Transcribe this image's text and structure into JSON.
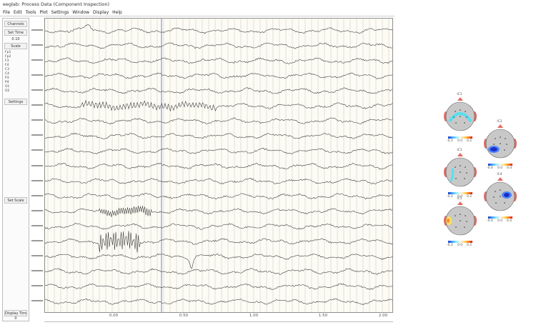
{
  "window": {
    "title": "eeglab: Process Data (Component Inspection)"
  },
  "menubar": [
    "File",
    "Edit",
    "Tools",
    "Plot",
    "Settings",
    "Window",
    "Display",
    "Help"
  ],
  "left_panel": {
    "buttons": [
      "Channels",
      "Set Time",
      "Scale",
      "Settings"
    ],
    "values": [
      "0.10",
      "1.0"
    ],
    "list": [
      "Fp1",
      "Fp2",
      "F3",
      "F4",
      "C3",
      "C4",
      "P3",
      "P4",
      "O1",
      "O2"
    ],
    "mid_button": "Set Scale",
    "bottom_button": "Display Time",
    "bottom_value": "0"
  },
  "time_axis": {
    "ticks": [
      "0.00",
      "0.50",
      "1.00",
      "1.50",
      "2.00"
    ]
  },
  "topoplots": [
    {
      "title": "IC1",
      "cmin": "-0.2",
      "cmid": "0.0",
      "cmax": "0.2",
      "pattern": "ring"
    },
    {
      "title": "IC2",
      "cmin": "-0.4",
      "cmid": "0.0",
      "cmax": "0.4",
      "pattern": "blue-left"
    },
    {
      "title": "IC3",
      "cmin": "-0.2",
      "cmid": "0.0",
      "cmax": "0.2",
      "pattern": "ring-small"
    },
    {
      "title": "IC4",
      "cmin": "-0.4",
      "cmid": "0.0",
      "cmax": "0.4",
      "pattern": "blue-right"
    },
    {
      "title": "IC5",
      "cmin": "-0.2",
      "cmid": "0.0",
      "cmax": "0.2",
      "pattern": "yellow-left"
    }
  ],
  "colors": {
    "trace": "#333333",
    "cursor": "#5a6fd6",
    "grid": "#c9c7bd",
    "plot_bg": "#fcfbf4",
    "head_fill": "#c8c8c8",
    "nose_ear": "#e06b63"
  }
}
